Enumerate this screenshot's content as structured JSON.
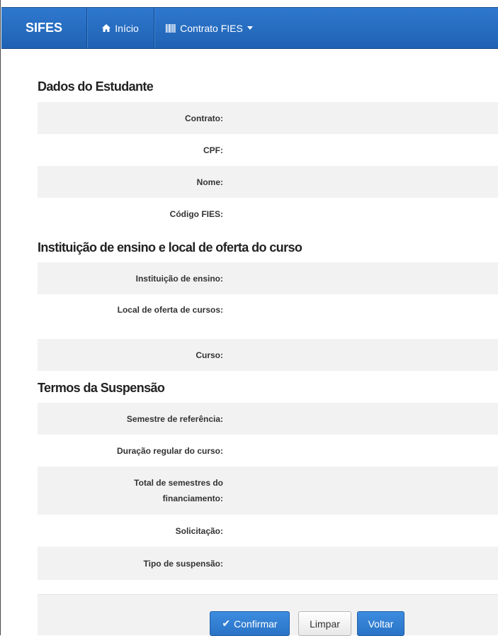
{
  "navbar": {
    "brand": "SIFES",
    "home_label": "Início",
    "contract_label": "Contrato FIES",
    "icons": {
      "home": "home-icon",
      "contract": "barcode-icon",
      "dropdown": "caret-down-icon"
    }
  },
  "sections": {
    "student": {
      "title": "Dados do Estudante",
      "contract_label": "Contrato:",
      "cpf_label": "CPF:",
      "name_label": "Nome:",
      "fies_code_label": "Código FIES:"
    },
    "institution": {
      "title": "Instituição de ensino e local de oferta do curso",
      "institution_label": "Instituição de ensino:",
      "location_label": "Local de oferta de cursos:",
      "course_label": "Curso:"
    },
    "suspension": {
      "title": "Termos da Suspensão",
      "semester_label": "Semestre de referência:",
      "duration_label": "Duração regular do curso:",
      "total_semesters_label": "Total de semestres do financiamento:",
      "request_label": "Solicitação:",
      "type_label": "Tipo de suspensão:"
    }
  },
  "actions": {
    "confirm": "Confirmar",
    "clear": "Limpar",
    "back": "Voltar"
  },
  "colors": {
    "navbar": "#2a6fc4",
    "primary_button": "#337ab7",
    "stripe": "#f2f2f2"
  }
}
